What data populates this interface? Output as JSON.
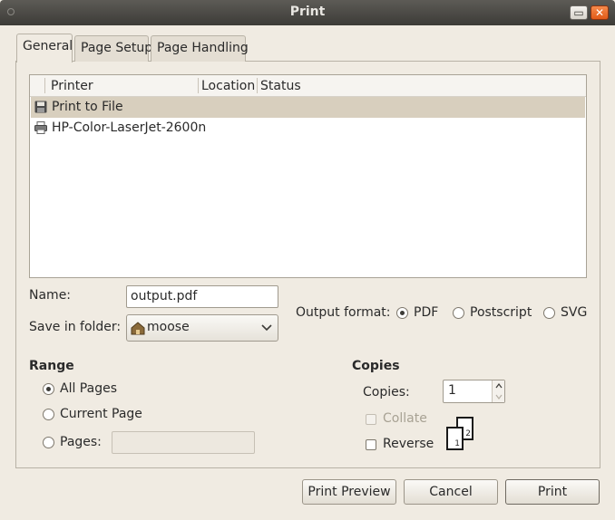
{
  "window": {
    "title": "Print"
  },
  "tabs": [
    {
      "label": "General",
      "active": true
    },
    {
      "label": "Page Setup",
      "active": false
    },
    {
      "label": "Page Handling",
      "active": false
    }
  ],
  "printer_list": {
    "columns": [
      "Printer",
      "Location",
      "Status"
    ],
    "rows": [
      {
        "name": "Print to File",
        "icon": "floppy-disk-icon",
        "selected": true
      },
      {
        "name": "HP-Color-LaserJet-2600n",
        "icon": "printer-icon",
        "selected": false
      }
    ]
  },
  "file": {
    "name_label": "Name:",
    "name_value": "output.pdf",
    "folder_label": "Save in folder:",
    "folder_value": "moose"
  },
  "output_format": {
    "label": "Output format:",
    "options": [
      {
        "label": "PDF",
        "selected": true
      },
      {
        "label": "Postscript",
        "selected": false
      },
      {
        "label": "SVG",
        "selected": false
      }
    ]
  },
  "range": {
    "title": "Range",
    "options": [
      {
        "label": "All Pages",
        "selected": true
      },
      {
        "label": "Current Page",
        "selected": false
      },
      {
        "label": "Pages:",
        "selected": false
      }
    ],
    "pages_value": ""
  },
  "copies": {
    "title": "Copies",
    "label": "Copies:",
    "value": "1",
    "collate_label": "Collate",
    "collate_checked": false,
    "collate_enabled": false,
    "reverse_label": "Reverse",
    "reverse_checked": false,
    "preview_page_1": "1",
    "preview_page_2": "2"
  },
  "buttons": {
    "preview": "Print Preview",
    "cancel": "Cancel",
    "print": "Print"
  },
  "colors": {
    "background": "#f0ebe2",
    "selected_row": "#d8cfbe",
    "titlebar": "#3c3b37",
    "close_button": "#e25a18"
  }
}
